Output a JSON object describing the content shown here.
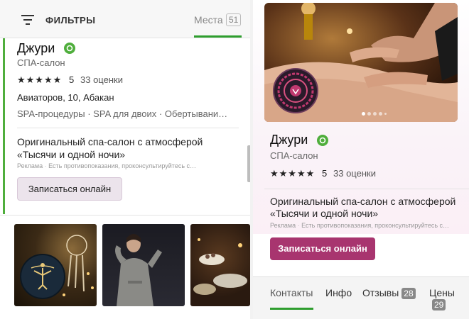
{
  "filters": {
    "label": "ФИЛЬТРЫ",
    "icon": "filter-icon"
  },
  "places_tab": {
    "label": "Места",
    "count": "51"
  },
  "listing": {
    "name": "Джури",
    "category": "СПА-салон",
    "stars": "★★★★★",
    "rating": "5",
    "reviews": "33 оценки",
    "address": "Авиаторов, 10, Абакан",
    "services": "SPA-процедуры · SPA для двоих · Обертывани…",
    "description_line1": "Оригинальный спа-салон с атмосферой",
    "description_line2": "«Тысячи и одной ночи»",
    "ad_label": "Реклама",
    "ad_disclaimer": "Есть противопоказания, проконсультируйтесь с…",
    "book_button": "Записаться онлайн"
  },
  "detail": {
    "name": "Джури",
    "category": "СПА-салон",
    "stars": "★★★★★",
    "rating": "5",
    "reviews": "33 оценки",
    "description_line1": "Оригинальный спа-салон с атмосферой",
    "description_line2": "«Тысячи и одной ночи»",
    "ad_label": "Реклама",
    "ad_disclaimer": "Есть противопоказания, проконсультируйтесь с…",
    "book_button": "Записаться онлайн",
    "tabs": [
      {
        "label": "Контакты"
      },
      {
        "label": "Инфо"
      },
      {
        "label": "Отзывы",
        "count": "28"
      },
      {
        "label": "Цены",
        "count": "29"
      }
    ]
  },
  "colors": {
    "accent_green": "#2e9e2e",
    "brand_purple": "#a8356f"
  }
}
